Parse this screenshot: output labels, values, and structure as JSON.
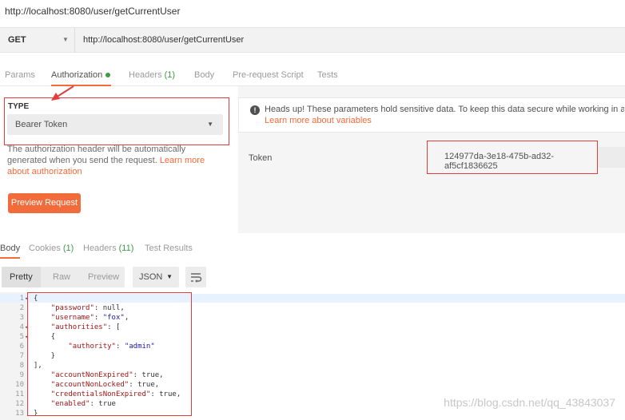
{
  "request": {
    "title": "http://localhost:8080/user/getCurrentUser",
    "method": "GET",
    "url": "http://localhost:8080/user/getCurrentUser"
  },
  "tabs": [
    {
      "label": "Params"
    },
    {
      "label": "Authorization"
    },
    {
      "label": "Headers",
      "count": "(1)"
    },
    {
      "label": "Body"
    },
    {
      "label": "Pre-request Script"
    },
    {
      "label": "Tests"
    }
  ],
  "auth": {
    "type_label": "TYPE",
    "type_value": "Bearer Token",
    "note": "The authorization header will be automatically generated when you send the request. ",
    "note_link": "Learn more about authorization",
    "preview_button": "Preview Request"
  },
  "warning": {
    "text": "Heads up! These parameters hold sensitive data. To keep this data secure while working in a colla",
    "link": "Learn more about variables"
  },
  "token": {
    "label": "Token",
    "value": "124977da-3e18-475b-ad32-af5cf1836625"
  },
  "response_tabs": [
    {
      "label": "Body"
    },
    {
      "label": "Cookies",
      "count": "(1)"
    },
    {
      "label": "Headers",
      "count": "(11)"
    },
    {
      "label": "Test Results"
    }
  ],
  "view": {
    "modes": [
      "Pretty",
      "Raw",
      "Preview"
    ],
    "format": "JSON"
  },
  "code_lines": [
    {
      "n": "1",
      "fold": true,
      "text": "{"
    },
    {
      "n": "2",
      "fold": false,
      "key": "\"password\"",
      "rest": ": null,"
    },
    {
      "n": "3",
      "fold": false,
      "key": "\"username\"",
      "rest": ": ",
      "str": "\"fox\"",
      "tail": ","
    },
    {
      "n": "4",
      "fold": true,
      "key": "\"authorities\"",
      "rest": ": ["
    },
    {
      "n": "5",
      "fold": true,
      "text": "    {"
    },
    {
      "n": "6",
      "fold": false,
      "key": "\"authority\"",
      "rest": ": ",
      "str": "\"admin\"",
      "tail": "",
      "indent": "        "
    },
    {
      "n": "7",
      "fold": false,
      "text": "    }"
    },
    {
      "n": "8",
      "fold": false,
      "text": "],"
    },
    {
      "n": "9",
      "fold": false,
      "key": "\"accountNonExpired\"",
      "rest": ": true,"
    },
    {
      "n": "10",
      "fold": false,
      "key": "\"accountNonLocked\"",
      "rest": ": true,"
    },
    {
      "n": "11",
      "fold": false,
      "key": "\"credentialsNonExpired\"",
      "rest": ": true,"
    },
    {
      "n": "12",
      "fold": false,
      "key": "\"enabled\"",
      "rest": ": true"
    },
    {
      "n": "13",
      "fold": false,
      "text": "}"
    }
  ],
  "watermark": "https://blog.csdn.net/qq_43843037",
  "colors": {
    "accent": "#f26b3a",
    "highlight_box": "#e23c3c",
    "count_green": "#3d9b46"
  }
}
